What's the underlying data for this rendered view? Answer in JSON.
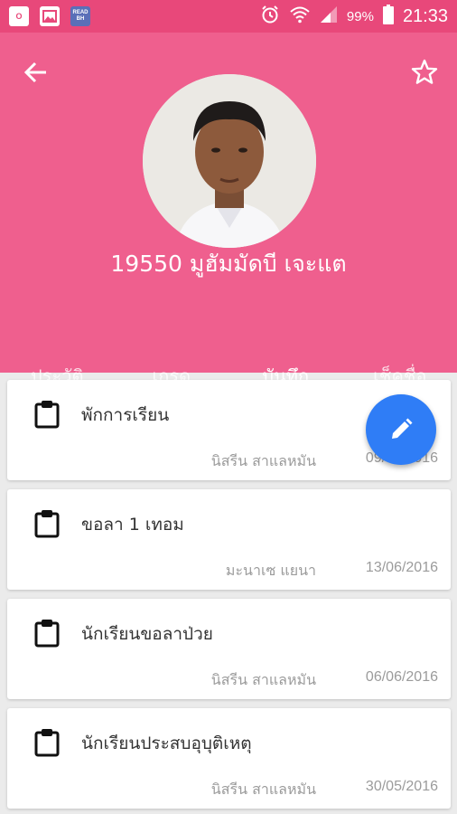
{
  "status_bar": {
    "apps": [
      "outlook-icon",
      "gallery-icon",
      "read-app-icon"
    ],
    "read_app_label": "READ BH",
    "battery": "99%",
    "time": "21:33"
  },
  "header": {
    "student_name": "19550 มูฮัมมัดบี  เจะแต",
    "color": "#ef5f8e"
  },
  "tabs": [
    {
      "label": "ประวัติ",
      "active": false
    },
    {
      "label": "เกรด",
      "active": false
    },
    {
      "label": "บันทึก",
      "active": true
    },
    {
      "label": "เช็คชื่อ",
      "active": false
    }
  ],
  "notes": [
    {
      "title": "พักการเรียน",
      "author": "นิสรีน  สาแลหมัน",
      "date": "09/06/2016"
    },
    {
      "title": "ขอลา 1 เทอม",
      "author": "มะนาเซ  แยนา",
      "date": "13/06/2016"
    },
    {
      "title": "นักเรียนขอลาป่วย",
      "author": "นิสรีน  สาแลหมัน",
      "date": "06/06/2016"
    },
    {
      "title": "นักเรียนประสบอุบุติเหตุ",
      "author": "นิสรีน  สาแลหมัน",
      "date": "30/05/2016"
    }
  ],
  "fab": {
    "icon": "pencil-icon",
    "color": "#2f7df6"
  }
}
